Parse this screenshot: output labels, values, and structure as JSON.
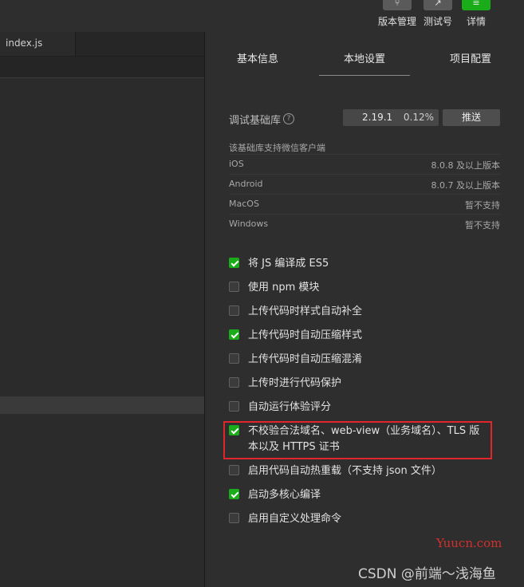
{
  "toolbar": {
    "version_mgmt": "版本管理",
    "test_account": "测试号",
    "details": "详情"
  },
  "editor": {
    "file_tab": "index.js"
  },
  "panel": {
    "tabs": [
      "基本信息",
      "本地设置",
      "项目配置"
    ],
    "active_tab": "本地设置",
    "base_lib_label": "调试基础库",
    "help_glyph": "?",
    "base_lib_version": "2.19.1",
    "base_lib_percent": "0.12%",
    "push_label": "推送",
    "support_note": "该基础库支持微信客户端",
    "clients": [
      {
        "os": "iOS",
        "req": "8.0.8 及以上版本"
      },
      {
        "os": "Android",
        "req": "8.0.7 及以上版本"
      },
      {
        "os": "MacOS",
        "req": "暂不支持"
      },
      {
        "os": "Windows",
        "req": "暂不支持"
      }
    ],
    "options": [
      {
        "label": "将 JS 编译成 ES5",
        "checked": true
      },
      {
        "label": "使用 npm 模块",
        "checked": false
      },
      {
        "label": "上传代码时样式自动补全",
        "checked": false
      },
      {
        "label": "上传代码时自动压缩样式",
        "checked": true
      },
      {
        "label": "上传代码时自动压缩混淆",
        "checked": false
      },
      {
        "label": "上传时进行代码保护",
        "checked": false
      },
      {
        "label": "自动运行体验评分",
        "checked": false
      },
      {
        "label": "不校验合法域名、web-view（业务域名）、TLS 版本以及 HTTPS 证书",
        "checked": true
      },
      {
        "label": "启用代码自动热重载（不支持 json 文件）",
        "checked": false
      },
      {
        "label": "启动多核心编译",
        "checked": true
      },
      {
        "label": "启用自定义处理命令",
        "checked": false
      }
    ]
  },
  "colors": {
    "accent": "#1aad19",
    "highlight": "#e0262b"
  },
  "watermark": {
    "site": "Yuucn.com",
    "author": "CSDN @前端～浅海鱼"
  }
}
